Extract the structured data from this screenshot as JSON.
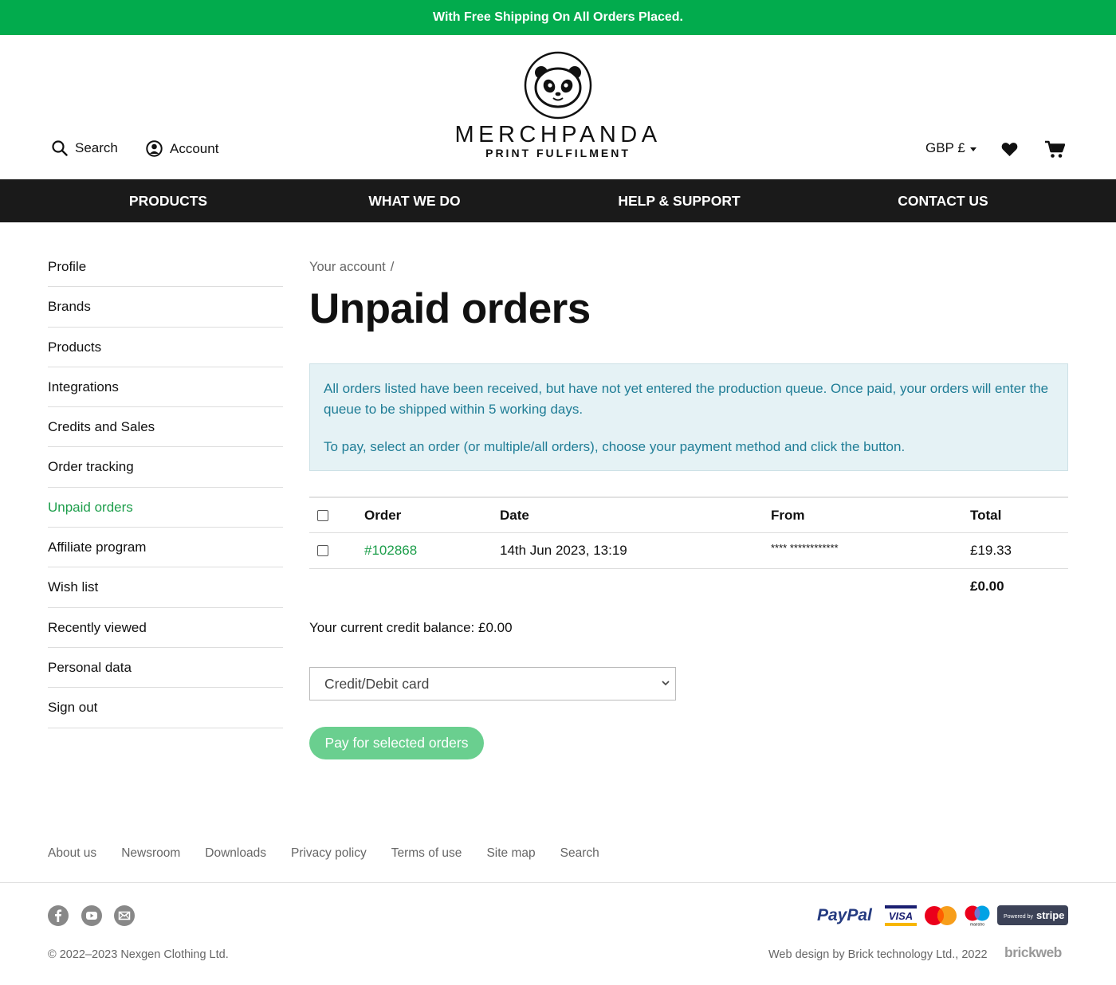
{
  "promo_bar": {
    "text": "With Free Shipping On All Orders Placed."
  },
  "header": {
    "search_label": "Search",
    "account_label": "Account",
    "logo_name": "MERCHPANDA",
    "logo_sub": "PRINT FULFILMENT",
    "currency": "GBP £"
  },
  "nav": {
    "items": [
      "PRODUCTS",
      "WHAT WE DO",
      "HELP & SUPPORT",
      "CONTACT US"
    ]
  },
  "sidebar": {
    "items": [
      "Profile",
      "Brands",
      "Products",
      "Integrations",
      "Credits and Sales",
      "Order tracking",
      "Unpaid orders",
      "Affiliate program",
      "Wish list",
      "Recently viewed",
      "Personal data",
      "Sign out"
    ],
    "active": "Unpaid orders"
  },
  "main": {
    "breadcrumb": "Your account",
    "breadcrumb_sep": "/",
    "title": "Unpaid orders",
    "info_p1": "All orders listed have been received, but have not yet entered the production queue. Once paid, your orders will enter the queue to be shipped within 5 working days.",
    "info_p2": "To pay, select an order (or multiple/all orders), choose your payment method and click the button.",
    "table": {
      "headers": {
        "order": "Order",
        "date": "Date",
        "from": "From",
        "total": "Total"
      },
      "rows": [
        {
          "order": "#102868",
          "date": "14th Jun 2023, 13:19",
          "from": "**** ************",
          "total": "£19.33"
        }
      ],
      "selected_total": "£0.00"
    },
    "credit_balance": "Your current credit balance: £0.00",
    "payment_method": "Credit/Debit card",
    "pay_button": "Pay for selected orders"
  },
  "footer": {
    "links": [
      "About us",
      "Newsroom",
      "Downloads",
      "Privacy policy",
      "Terms of use",
      "Site map",
      "Search"
    ],
    "copyright": "© 2022–2023 Nexgen Clothing Ltd.",
    "web_credit": "Web design by Brick technology Ltd., 2022",
    "brickweb": "brickweb",
    "payment_logos": {
      "paypal": "PayPal",
      "visa": "VISA",
      "maestro": "maestro",
      "stripe_powered": "Powered by",
      "stripe": "stripe"
    }
  },
  "colors": {
    "brand_green": "#02ab4d",
    "link_green": "#1d9e4b",
    "nav_bg": "#1a1a1a",
    "info_bg": "#e5f2f5",
    "info_text": "#1f7d96",
    "button_green": "#6acf8f"
  }
}
